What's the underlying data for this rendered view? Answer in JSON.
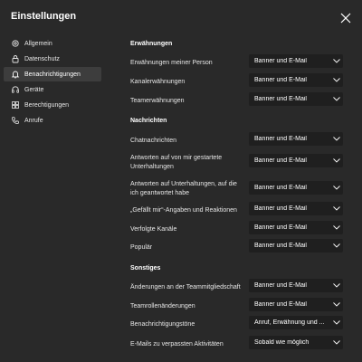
{
  "title": "Einstellungen",
  "sidebar": {
    "items": [
      {
        "label": "Allgemein",
        "icon": "gear-icon"
      },
      {
        "label": "Datenschutz",
        "icon": "lock-icon"
      },
      {
        "label": "Benachrichtigungen",
        "icon": "bell-icon",
        "active": true
      },
      {
        "label": "Geräte",
        "icon": "headset-icon"
      },
      {
        "label": "Berechtigungen",
        "icon": "grid-icon"
      },
      {
        "label": "Anrufe",
        "icon": "phone-icon"
      }
    ]
  },
  "sections": {
    "mentions": {
      "title": "Erwähnungen",
      "rows": [
        {
          "label": "Erwähnungen meiner Person",
          "value": "Banner und E-Mail"
        },
        {
          "label": "Kanalerwähnungen",
          "value": "Banner und E-Mail"
        },
        {
          "label": "Teamerwähnungen",
          "value": "Banner und E-Mail"
        }
      ]
    },
    "messages": {
      "title": "Nachrichten",
      "rows": [
        {
          "label": "Chatnachrichten",
          "value": "Banner und E-Mail"
        },
        {
          "label": "Antworten auf von mir gestartete Unterhaltungen",
          "value": "Banner und E-Mail"
        },
        {
          "label": "Antworten auf Unterhaltungen, auf die ich geantwortet habe",
          "value": "Banner und E-Mail"
        },
        {
          "label": "„Gefällt mir“-Angaben und Reaktionen",
          "value": "Banner und E-Mail"
        },
        {
          "label": "Verfolgte Kanäle",
          "value": "Banner und E-Mail"
        },
        {
          "label": "Populär",
          "value": "Banner und E-Mail"
        }
      ]
    },
    "other": {
      "title": "Sonstiges",
      "rows": [
        {
          "label": "Änderungen an der Teammitgliedschaft",
          "value": "Banner und E-Mail"
        },
        {
          "label": "Teamrollenänderungen",
          "value": "Banner und E-Mail"
        },
        {
          "label": "Benachrichtigungstöne",
          "value": "Anruf, Erwähnung und ..."
        },
        {
          "label": "E-Mails zu verpassten Aktivitäten",
          "value": "Sobald wie möglich"
        }
      ]
    }
  },
  "colors": {
    "background": "#292929",
    "dropdown": "#1f1f1f",
    "active_nav": "#3d3d3d",
    "text": "#ffffff"
  }
}
